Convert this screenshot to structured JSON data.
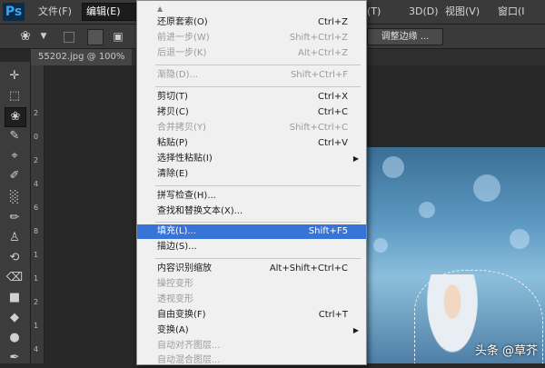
{
  "menubar": {
    "logo": "Ps",
    "file": "文件(F)",
    "edit": "编辑(E)",
    "type": "(T)",
    "three_d": "3D(D)",
    "view": "视图(V)",
    "window": "窗口(I"
  },
  "options": {
    "refine_edge": "调整边缘 ..."
  },
  "document": {
    "tab": "55202.jpg @ 100%"
  },
  "ruler": [
    "2",
    "0",
    "2",
    "4",
    "6",
    "8",
    "1",
    "1",
    "2",
    "1",
    "4"
  ],
  "dropdown": {
    "scroll_up_icon": "up-arrow",
    "items": [
      {
        "label": "还原套索(O)",
        "shortcut": "Ctrl+Z",
        "disabled": false
      },
      {
        "label": "前进一步(W)",
        "shortcut": "Shift+Ctrl+Z",
        "disabled": true
      },
      {
        "label": "后退一步(K)",
        "shortcut": "Alt+Ctrl+Z",
        "disabled": true
      },
      {
        "label": "渐隐(D)...",
        "shortcut": "Shift+Ctrl+F",
        "disabled": true
      },
      {
        "label": "剪切(T)",
        "shortcut": "Ctrl+X",
        "disabled": false
      },
      {
        "label": "拷贝(C)",
        "shortcut": "Ctrl+C",
        "disabled": false
      },
      {
        "label": "合并拷贝(Y)",
        "shortcut": "Shift+Ctrl+C",
        "disabled": true
      },
      {
        "label": "粘贴(P)",
        "shortcut": "Ctrl+V",
        "disabled": false
      },
      {
        "label": "选择性粘贴(I)",
        "shortcut": "",
        "disabled": false,
        "submenu": true
      },
      {
        "label": "清除(E)",
        "shortcut": "",
        "disabled": false
      },
      {
        "label": "拼写检查(H)...",
        "shortcut": "",
        "disabled": false
      },
      {
        "label": "查找和替换文本(X)...",
        "shortcut": "",
        "disabled": false
      },
      {
        "label": "填充(L)...",
        "shortcut": "Shift+F5",
        "disabled": false,
        "highlight": true
      },
      {
        "label": "描边(S)...",
        "shortcut": "",
        "disabled": false
      },
      {
        "label": "内容识别缩放",
        "shortcut": "Alt+Shift+Ctrl+C",
        "disabled": false
      },
      {
        "label": "操控变形",
        "shortcut": "",
        "disabled": true
      },
      {
        "label": "透视变形",
        "shortcut": "",
        "disabled": true
      },
      {
        "label": "自由变换(F)",
        "shortcut": "Ctrl+T",
        "disabled": false
      },
      {
        "label": "变换(A)",
        "shortcut": "",
        "disabled": false,
        "submenu": true
      },
      {
        "label": "自动对齐图层...",
        "shortcut": "",
        "disabled": true
      },
      {
        "label": "自动混合图层...",
        "shortcut": "",
        "disabled": true
      }
    ]
  },
  "watermark": "头条 @草芥",
  "colors": {
    "highlight": "#3874d8",
    "menu_bg": "#f0f0f0",
    "app_bg": "#282828"
  }
}
